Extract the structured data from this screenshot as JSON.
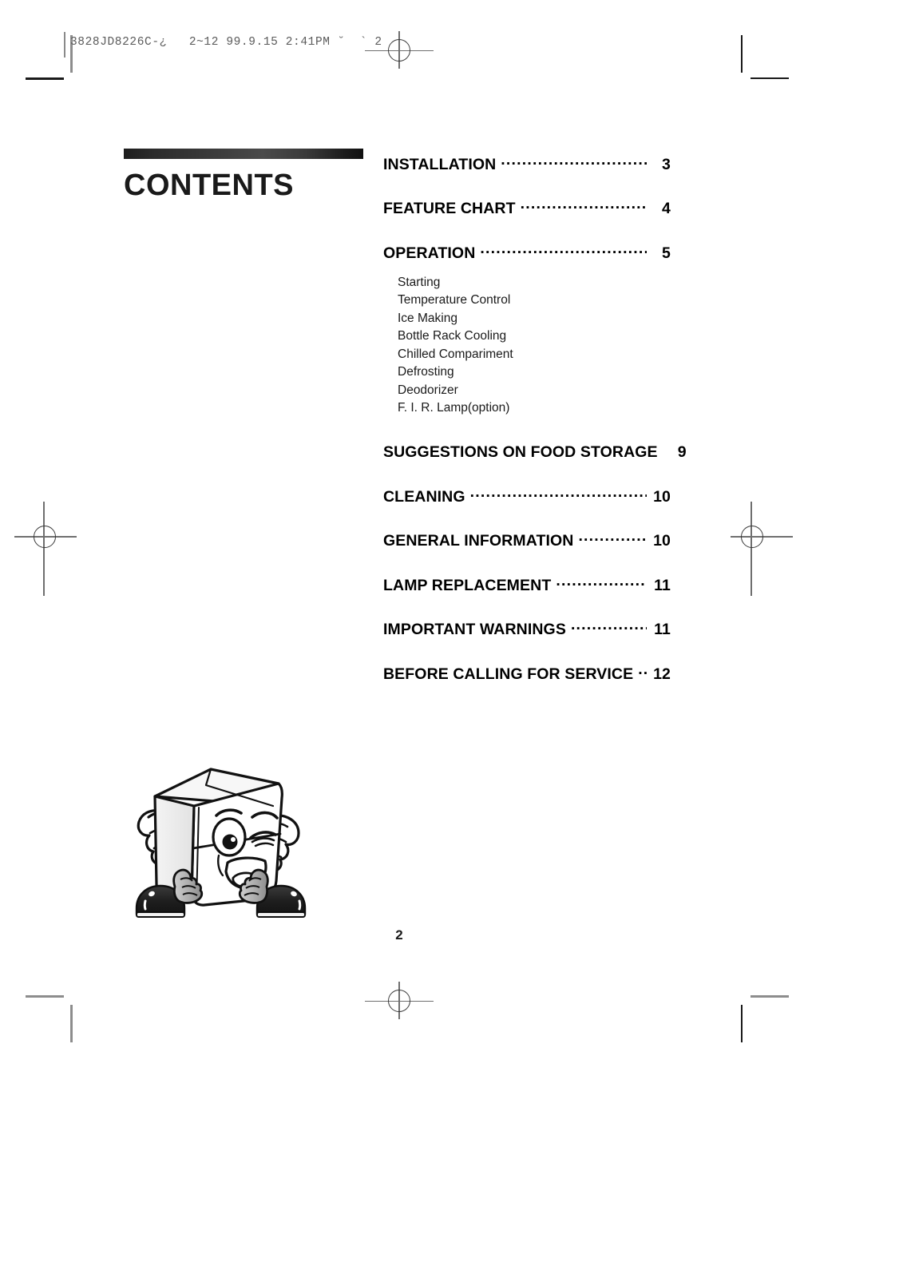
{
  "document": {
    "header_code": "3828JD8226C-¿   2~12 99.9.15 2:41PM ˘  ` 2",
    "page_number": "2"
  },
  "title": {
    "heading": "CONTENTS"
  },
  "toc": {
    "entries": [
      {
        "label": "INSTALLATION",
        "page": "3"
      },
      {
        "label": "FEATURE CHART",
        "page": "4"
      },
      {
        "label": "OPERATION",
        "page": "5"
      },
      {
        "label": "SUGGESTIONS ON FOOD STORAGE",
        "page": "9"
      },
      {
        "label": "CLEANING",
        "page": "10"
      },
      {
        "label": "GENERAL INFORMATION",
        "page": "10"
      },
      {
        "label": "LAMP REPLACEMENT",
        "page": "11"
      },
      {
        "label": "IMPORTANT WARNINGS",
        "page": "11"
      },
      {
        "label": "BEFORE CALLING FOR SERVICE",
        "page": "12"
      }
    ],
    "operation_subitems": [
      "Starting",
      "Temperature Control",
      "Ice Making",
      "Bottle Rack Cooling",
      "Chilled Compariment",
      "Defrosting",
      "Deodorizer",
      "F. I. R. Lamp(option)"
    ]
  },
  "illustration": {
    "name": "refrigerator-mascot",
    "description": "Cartoon refrigerator character winking and waving"
  },
  "colors": {
    "text": "#000000",
    "title_bar_dark": "#1d1d1d",
    "title_bar_light": "#4a4a4a",
    "reg_mark": "#3a3a3a",
    "header_code": "#5b5b5b"
  }
}
